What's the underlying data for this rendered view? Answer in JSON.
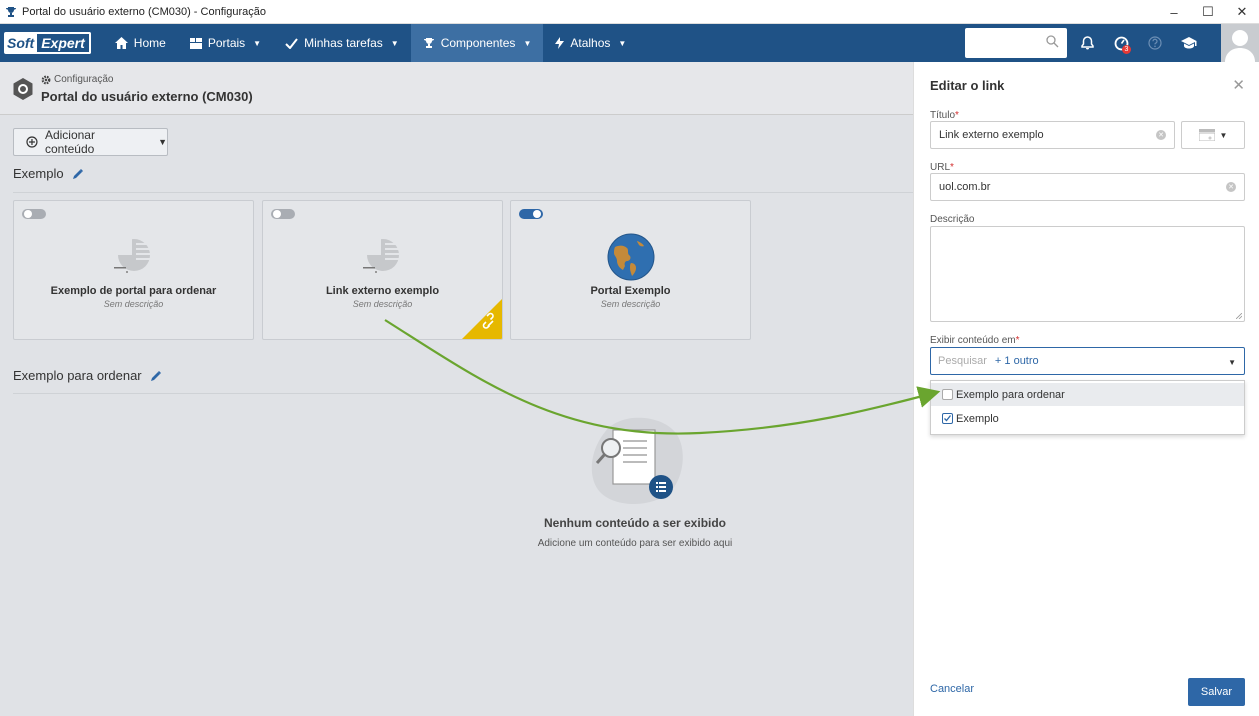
{
  "window": {
    "title": "Portal do usuário externo (CM030) - Configuração",
    "minimize": "–",
    "maximize": "☐",
    "close": "✕"
  },
  "logo": {
    "part1": "Soft",
    "part2": "Expert"
  },
  "nav": {
    "items": [
      {
        "label": "Home",
        "icon": "home-icon",
        "active": false
      },
      {
        "label": "Portais",
        "icon": "portals-icon",
        "active": false
      },
      {
        "label": "Minhas tarefas",
        "icon": "check-icon",
        "active": false
      },
      {
        "label": "Componentes",
        "icon": "trophy-icon",
        "active": true
      },
      {
        "label": "Atalhos",
        "icon": "bolt-icon",
        "active": false
      }
    ],
    "notification_badge": "3"
  },
  "page": {
    "breadcrumb": "Configuração",
    "title": "Portal do usuário externo (CM030)",
    "add_button": "Adicionar conteúdo"
  },
  "sections": [
    {
      "title": "Exemplo",
      "cards": [
        {
          "title": "Exemplo de portal para ordenar",
          "description": "Sem descrição",
          "enabled": false
        },
        {
          "title": "Link externo exemplo",
          "description": "Sem descrição",
          "enabled": false,
          "is_link": true
        },
        {
          "title": "Portal Exemplo",
          "description": "Sem descrição",
          "enabled": true
        }
      ]
    },
    {
      "title": "Exemplo para ordenar",
      "empty_title": "Nenhum conteúdo a ser exibido",
      "empty_subtitle": "Adicione um conteúdo para ser exibido aqui"
    }
  ],
  "panel": {
    "title": "Editar o link",
    "title_label": "Título",
    "title_value": "Link externo exemplo",
    "url_label": "URL",
    "url_value": "uol.com.br",
    "description_label": "Descrição",
    "description_value": "",
    "display_label": "Exibir conteúdo em",
    "display_placeholder": "Pesquisar",
    "display_more": "+ 1 outro",
    "required_mark": "*",
    "options": [
      {
        "label": "Exemplo para ordenar",
        "checked": false
      },
      {
        "label": "Exemplo",
        "checked": true
      }
    ],
    "cancel": "Cancelar",
    "save": "Salvar"
  },
  "colors": {
    "navbar": "#1f5286",
    "nav_active": "#3d6fa3",
    "accent": "#2e67a7",
    "link_corner": "#e6b800",
    "arrow": "#6aa52f"
  }
}
